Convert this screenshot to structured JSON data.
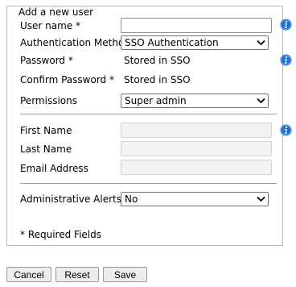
{
  "form": {
    "legend": "Add a new user",
    "username": {
      "label": "User name *",
      "value": ""
    },
    "auth_method": {
      "label": "Authentication Method",
      "selected": "SSO Authentication"
    },
    "password": {
      "label": "Password *",
      "value": "Stored in SSO"
    },
    "confirm_password": {
      "label": "Confirm Password *",
      "value": "Stored in SSO"
    },
    "permissions": {
      "label": "Permissions",
      "selected": "Super admin"
    },
    "first_name": {
      "label": "First Name",
      "value": ""
    },
    "last_name": {
      "label": "Last Name",
      "value": ""
    },
    "email": {
      "label": "Email Address",
      "value": ""
    },
    "alerts": {
      "label": "Administrative Alerts",
      "selected": "No"
    },
    "required_note": "* Required Fields"
  },
  "buttons": {
    "cancel": "Cancel",
    "reset": "Reset",
    "save": "Save"
  },
  "colors": {
    "info_icon": "#1f6fd1",
    "border": "#b8b8b8"
  },
  "icons": {
    "info": "info-icon",
    "chevron": "chevron-down-icon"
  }
}
